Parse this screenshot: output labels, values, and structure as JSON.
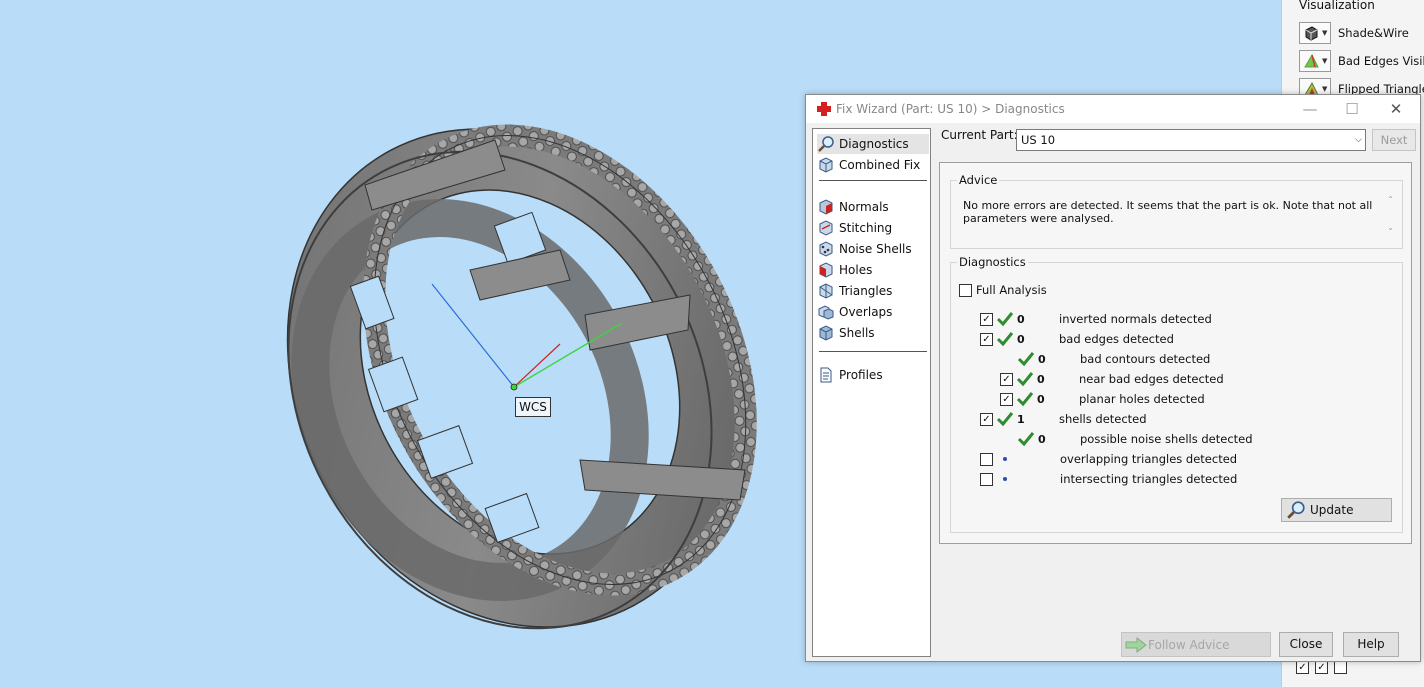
{
  "viewport": {
    "wcs_label": "WCS",
    "background": "#b9ddf8"
  },
  "visualization": {
    "title": "Visualization",
    "items": [
      {
        "label": "Shade&Wire",
        "icon": "shade-wire-icon"
      },
      {
        "label": "Bad Edges Visible",
        "icon": "bad-edges-icon"
      },
      {
        "label": "Flipped Triangles",
        "icon": "flipped-triangles-icon"
      }
    ]
  },
  "dialog": {
    "title": "Fix Wizard (Part: US 10) > Diagnostics",
    "nav": {
      "top": [
        {
          "label": "Diagnostics",
          "icon": "magnifier-icon",
          "selected": true
        },
        {
          "label": "Combined Fix",
          "icon": "cube-icon"
        }
      ],
      "tools": [
        {
          "label": "Normals",
          "icon": "normals-icon"
        },
        {
          "label": "Stitching",
          "icon": "stitching-icon"
        },
        {
          "label": "Noise Shells",
          "icon": "noise-shells-icon"
        },
        {
          "label": "Holes",
          "icon": "holes-icon"
        },
        {
          "label": "Triangles",
          "icon": "triangles-icon"
        },
        {
          "label": "Overlaps",
          "icon": "overlaps-icon"
        },
        {
          "label": "Shells",
          "icon": "shells-icon"
        }
      ],
      "bottom": [
        {
          "label": "Profiles",
          "icon": "document-icon"
        }
      ]
    },
    "current_part_label": "Current Part:",
    "current_part_value": "US 10",
    "next_label": "Next",
    "advice_title": "Advice",
    "advice_text": "No more errors are detected. It seems that the part is ok. Note that not all parameters were analysed.",
    "diagnostics_title": "Diagnostics",
    "full_analysis_label": "Full Analysis",
    "diagnostics": [
      {
        "checkbox": true,
        "checked": true,
        "status": "ok",
        "count": "0",
        "label": "inverted normals detected",
        "indent": 0
      },
      {
        "checkbox": true,
        "checked": true,
        "status": "ok",
        "count": "0",
        "label": "bad edges detected",
        "indent": 0
      },
      {
        "checkbox": false,
        "checked": false,
        "status": "ok",
        "count": "0",
        "label": "bad contours detected",
        "indent": 1
      },
      {
        "checkbox": true,
        "checked": true,
        "status": "ok",
        "count": "0",
        "label": "near bad edges detected",
        "indent": 1
      },
      {
        "checkbox": true,
        "checked": true,
        "status": "ok",
        "count": "0",
        "label": "planar holes detected",
        "indent": 1
      },
      {
        "checkbox": true,
        "checked": true,
        "status": "ok",
        "count": "1",
        "label": "shells detected",
        "indent": 0
      },
      {
        "checkbox": false,
        "checked": false,
        "status": "ok",
        "count": "0",
        "label": "possible noise shells detected",
        "indent": 1
      },
      {
        "checkbox": true,
        "checked": false,
        "status": "none",
        "count": "",
        "label": "overlapping triangles detected",
        "indent": 0
      },
      {
        "checkbox": true,
        "checked": false,
        "status": "none",
        "count": "",
        "label": "intersecting triangles detected",
        "indent": 0
      }
    ],
    "update_label": "Update",
    "follow_advice_label": "Follow Advice",
    "close_label": "Close",
    "help_label": "Help"
  },
  "colors": {
    "check_green": "#2f8c2f",
    "accent_red": "#d42020"
  }
}
